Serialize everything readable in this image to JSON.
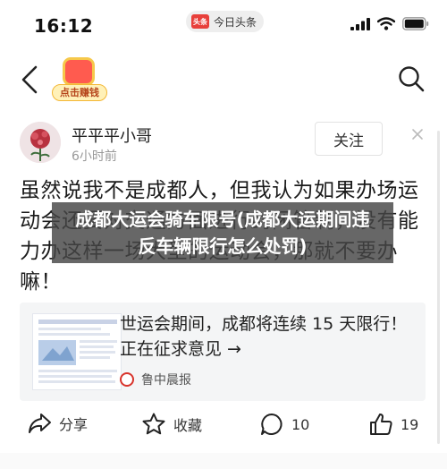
{
  "status_bar": {
    "time": "16:12",
    "app_logo_text": "头条",
    "app_name": "今日头条"
  },
  "nav": {
    "promo_label": "点击赚钱"
  },
  "author": {
    "name": "平平平小哥",
    "time": "6小时前",
    "follow_label": "关注"
  },
  "post": {
    "text": "虽然说我不是成都人，但我认为如果办场运动会还要对交通方面进行封闭管制，没有能力办这样一场大型的运动会，那就不要办嘛！"
  },
  "overlay": {
    "line1": "成都大运会骑车限号(成都大运期间违",
    "line2": "反车辆限行怎么处罚)"
  },
  "share_card": {
    "title": "世运会期间，成都将连续 15 天限行！正在征求意见 →",
    "source": "鲁中晨报"
  },
  "actions": {
    "share_label": "分享",
    "favorite_label": "收藏",
    "comment_count": "10",
    "like_count": "19"
  },
  "colors": {
    "brand_red": "#e8403b",
    "overlay_bg": "#464646"
  }
}
